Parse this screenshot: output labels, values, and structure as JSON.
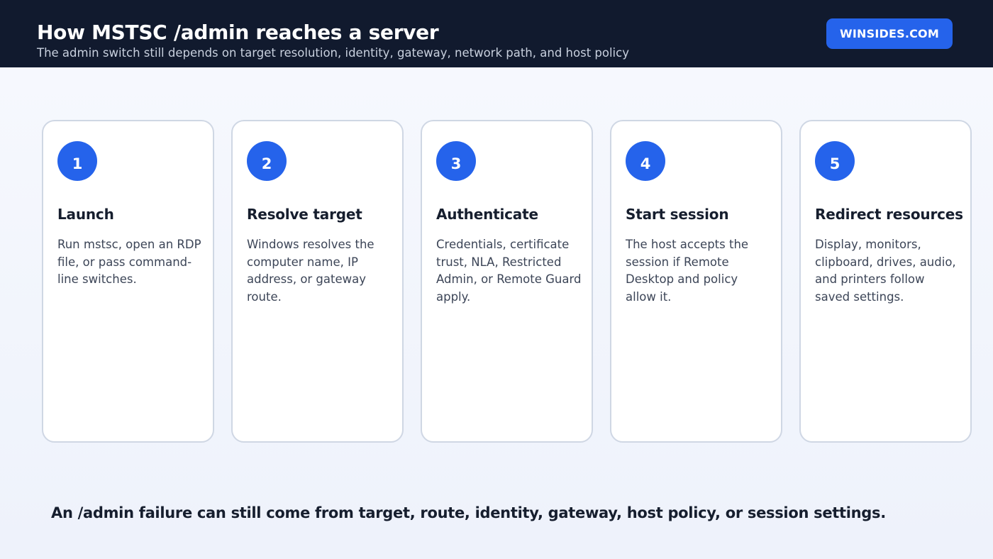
{
  "header": {
    "title": "How MSTSC /admin reaches a server",
    "subtitle": "The admin switch still depends on target resolution, identity, gateway, network path, and host policy",
    "brand": "WINSIDES.COM"
  },
  "steps": [
    {
      "number": "1",
      "title": "Launch",
      "description": "Run mstsc, open an RDP file, or pass command-line switches."
    },
    {
      "number": "2",
      "title": "Resolve target",
      "description": "Windows resolves the computer name, IP address, or gateway route."
    },
    {
      "number": "3",
      "title": "Authenticate",
      "description": "Credentials, certificate trust, NLA, Restricted Admin, or Remote Guard apply."
    },
    {
      "number": "4",
      "title": "Start session",
      "description": "The host accepts the session if Remote Desktop and policy allow it."
    },
    {
      "number": "5",
      "title": "Redirect resources",
      "description": "Display, monitors, clipboard, drives, audio, and printers follow saved settings."
    }
  ],
  "footer": "An /admin failure can still come from target, route, identity, gateway, host policy, or session settings.",
  "colors": {
    "header_bg": "#111a2e",
    "accent": "#2563eb",
    "card_border": "#cfd7e4"
  }
}
